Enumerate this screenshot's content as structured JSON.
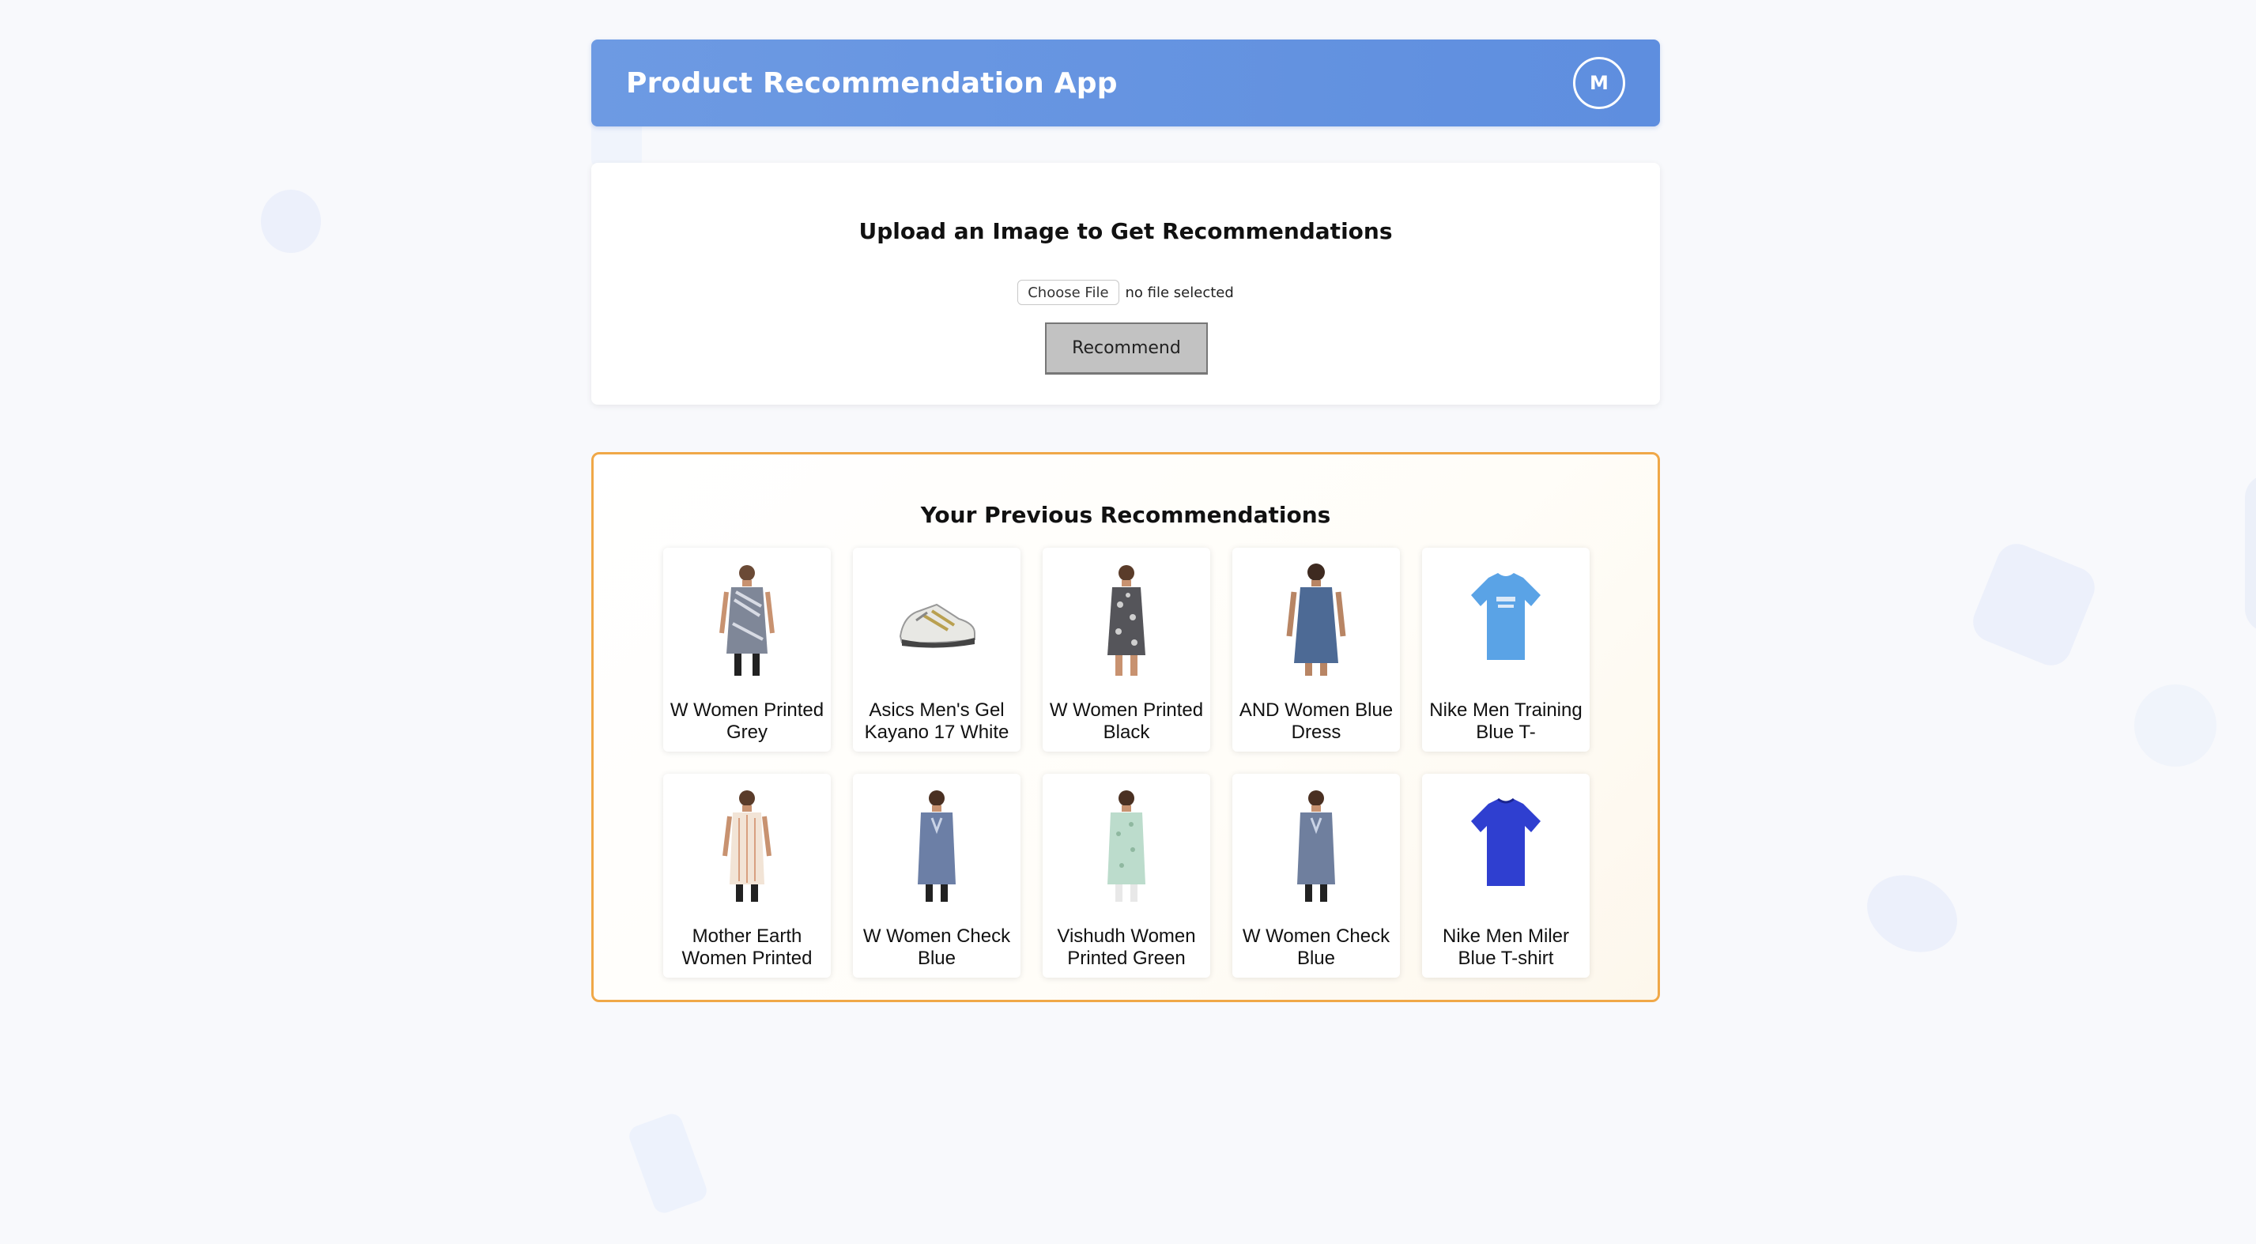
{
  "header": {
    "title": "Product Recommendation App",
    "avatar_initial": "M"
  },
  "upload": {
    "title": "Upload an Image to Get Recommendations",
    "choose_file_label": "Choose File",
    "file_status": "no file selected",
    "recommend_label": "Recommend"
  },
  "previous": {
    "title": "Your Previous Recommendations",
    "items": [
      {
        "name": "W Women Printed Grey",
        "icon": "woman-grey-printed-kurta"
      },
      {
        "name": "Asics Men's Gel Kayano 17 White",
        "icon": "white-running-shoe"
      },
      {
        "name": "W Women Printed Black",
        "icon": "woman-black-printed-dress"
      },
      {
        "name": "AND Women Blue Dress",
        "icon": "woman-blue-denim-dress"
      },
      {
        "name": "Nike Men Training Blue T-",
        "icon": "light-blue-tshirt"
      },
      {
        "name": "Mother Earth Women Printed",
        "icon": "woman-white-printed-kurta"
      },
      {
        "name": "W Women Check Blue",
        "icon": "woman-blue-check-kurta"
      },
      {
        "name": "Vishudh Women Printed Green",
        "icon": "woman-green-printed-kurta"
      },
      {
        "name": "W Women Check Blue",
        "icon": "woman-blue-check-kurta"
      },
      {
        "name": "Nike Men Miler Blue T-shirt",
        "icon": "royal-blue-tshirt"
      }
    ]
  },
  "colors": {
    "header_blue": "#5e8edf",
    "accent_orange": "#f0a848"
  }
}
